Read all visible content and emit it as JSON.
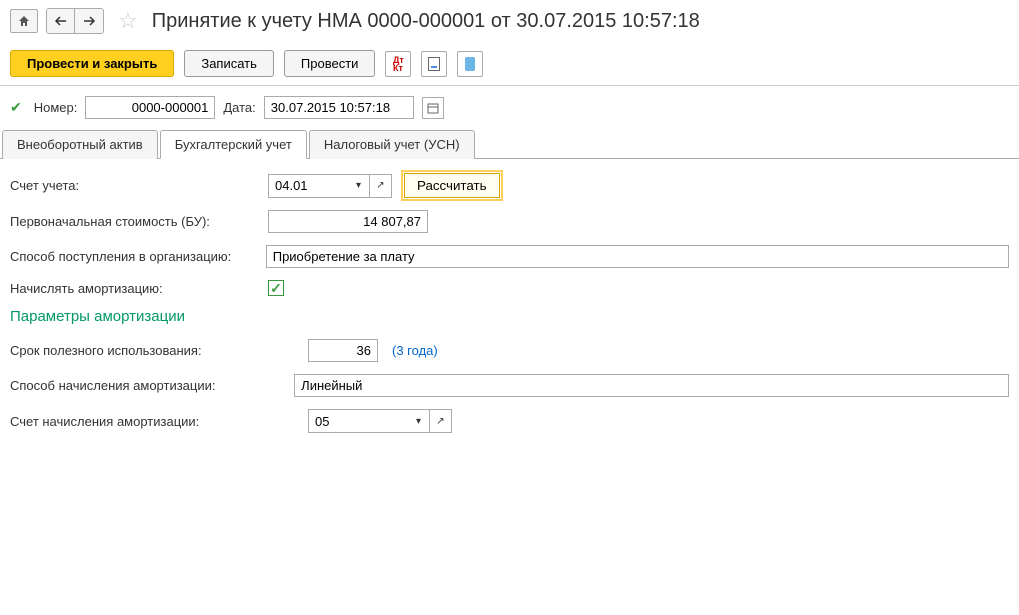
{
  "title": "Принятие к учету НМА 0000-000001 от 30.07.2015 10:57:18",
  "toolbar": {
    "post_close": "Провести и закрыть",
    "save": "Записать",
    "post": "Провести"
  },
  "number_row": {
    "number_label": "Номер:",
    "number_value": "0000-000001",
    "date_label": "Дата:",
    "date_value": "30.07.2015 10:57:18"
  },
  "tabs": {
    "tab1": "Внеоборотный актив",
    "tab2": "Бухгалтерский учет",
    "tab3": "Налоговый учет (УСН)"
  },
  "form": {
    "account_label": "Счет учета:",
    "account_value": "04.01",
    "calc_btn": "Рассчитать",
    "cost_label": "Первоначальная стоимость (БУ):",
    "cost_value": "14 807,87",
    "method_label": "Способ поступления в организацию:",
    "method_value": "Приобретение за плату",
    "amort_check_label": "Начислять амортизацию:",
    "section_title": "Параметры амортизации",
    "term_label": "Срок полезного использования:",
    "term_value": "36",
    "term_hint": "(3 года)",
    "amort_method_label": "Способ начисления амортизации:",
    "amort_method_value": "Линейный",
    "amort_account_label": "Счет начисления амортизации:",
    "amort_account_value": "05"
  }
}
